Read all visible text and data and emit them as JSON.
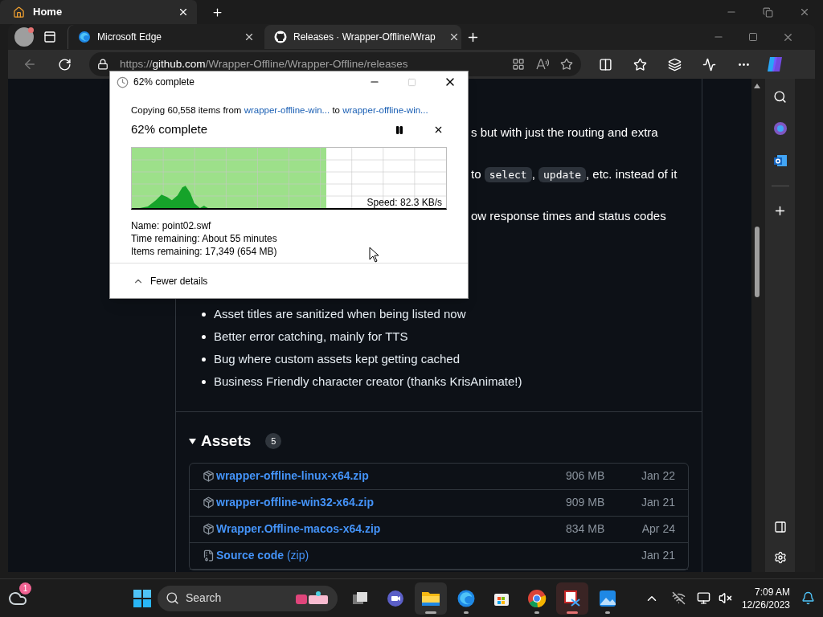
{
  "back_window": {
    "title": "Home"
  },
  "browser": {
    "tabs": [
      {
        "title": "Microsoft Edge",
        "kind": "edge",
        "selected": false
      },
      {
        "title": "Releases · Wrapper-Offline/Wrap",
        "kind": "github",
        "selected": true
      }
    ],
    "address": {
      "scheme": "https://",
      "host": "github.com",
      "path": "/Wrapper-Offline/Wrapper-Offline/releases"
    }
  },
  "page": {
    "note_lines": [
      [
        {
          "kind": "text",
          "text": "s but with just the routing and extra"
        }
      ],
      [
        {
          "kind": "text",
          "text": "to "
        },
        {
          "kind": "code",
          "text": "select"
        },
        {
          "kind": "text",
          "text": ", "
        },
        {
          "kind": "code",
          "text": "update"
        },
        {
          "kind": "text",
          "text": ", etc. instead of it"
        }
      ],
      [
        {
          "kind": "text",
          "text": "ow response times and status codes"
        }
      ]
    ],
    "fixes": [
      "Asset titles are sanitized when being listed now",
      "Better error catching, mainly for TTS",
      "Bug where custom assets kept getting cached",
      "Business Friendly character creator (thanks KrisAnimate!)"
    ],
    "assets": {
      "title": "Assets",
      "count": "5",
      "expanded": true,
      "rows": [
        {
          "kind": "package",
          "name": "wrapper-offline-linux-x64.zip",
          "size": "906 MB",
          "date": "Jan 22"
        },
        {
          "kind": "package",
          "name": "wrapper-offline-win32-x64.zip",
          "size": "909 MB",
          "date": "Jan 21"
        },
        {
          "kind": "package",
          "name": "Wrapper.Offline-macos-x64.zip",
          "size": "834 MB",
          "date": "Apr 24"
        },
        {
          "kind": "source",
          "name": "Source code",
          "suffix": "(zip)",
          "date": "Jan 21"
        }
      ]
    }
  },
  "copy_dialog": {
    "title": "62% complete",
    "prefix": "Copying 60,558 items from",
    "source": "wrapper-offline-win...",
    "middle": "to",
    "destination": "wrapper-offline-win...",
    "heading": "62% complete",
    "level": 0.62,
    "speed": "Speed: 82.3 KB/s",
    "details": [
      {
        "label": "Name:",
        "value": "point02.swf"
      },
      {
        "label": "Time remaining:",
        "value": "About 55 minutes"
      },
      {
        "label": "Items remaining:",
        "value": "17,349 (654 MB)"
      }
    ],
    "toggle": "Fewer details"
  },
  "taskbar": {
    "weather_badge": "1",
    "search_label": "Search",
    "apps": [
      {
        "kind": "taskview",
        "running": false,
        "active": false
      },
      {
        "kind": "meet",
        "running": false,
        "active": false
      },
      {
        "kind": "explorer",
        "running": true,
        "active": true
      },
      {
        "kind": "edge",
        "running": true,
        "active": false
      },
      {
        "kind": "store",
        "running": false,
        "active": false
      },
      {
        "kind": "chrome",
        "running": true,
        "active": false
      },
      {
        "kind": "snip",
        "running": true,
        "active": true
      },
      {
        "kind": "photos",
        "running": true,
        "active": false
      }
    ],
    "time": "7:09 AM",
    "date": "12/26/2023"
  }
}
